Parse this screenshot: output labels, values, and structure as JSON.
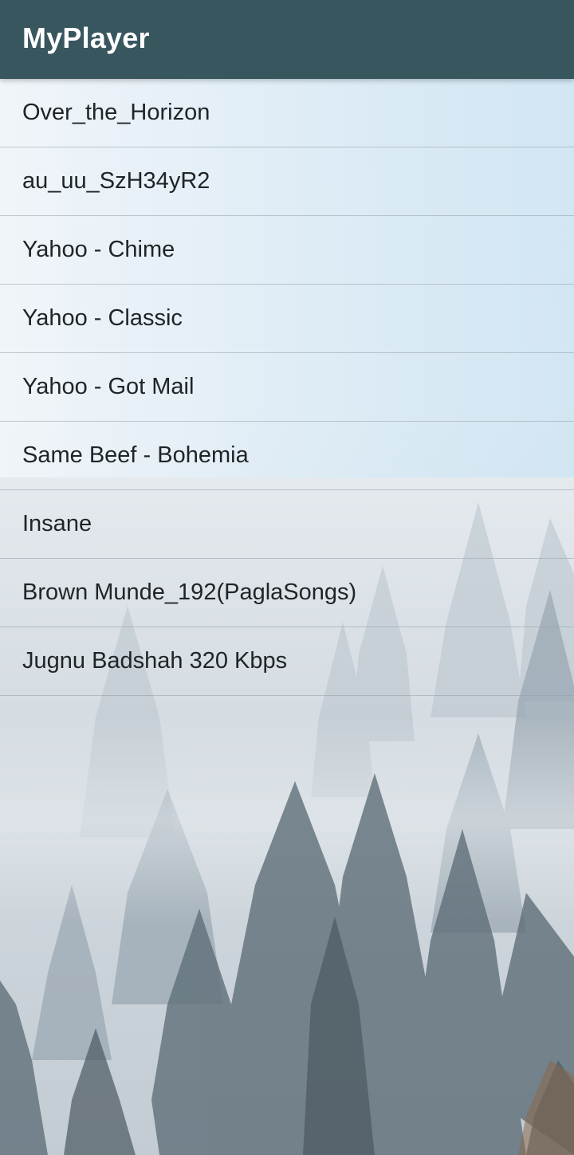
{
  "app_bar": {
    "title": "MyPlayer",
    "color": "#37565e"
  },
  "song_list": {
    "items": [
      {
        "title": "Over_the_Horizon"
      },
      {
        "title": "au_uu_SzH34yR2"
      },
      {
        "title": "Yahoo - Chime"
      },
      {
        "title": "Yahoo - Classic"
      },
      {
        "title": "Yahoo - Got Mail"
      },
      {
        "title": "Same Beef - Bohemia"
      },
      {
        "title": "Insane"
      },
      {
        "title": "Brown Munde_192(PaglaSongs)"
      },
      {
        "title": "Jugnu Badshah 320 Kbps"
      }
    ]
  },
  "background": {
    "description_icon": "foggy-forest-image"
  }
}
